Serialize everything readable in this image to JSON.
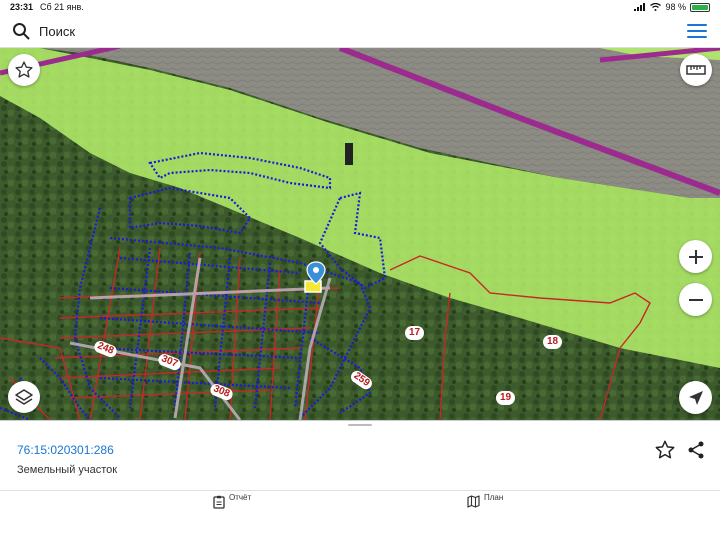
{
  "status_bar": {
    "time": "23:31",
    "date": "Сб 21 янв.",
    "battery": "98 %",
    "battery_level": 0.98
  },
  "search": {
    "placeholder": "Поиск",
    "search_icon": "search-icon",
    "menu_icon": "menu-icon"
  },
  "map": {
    "controls": {
      "favorite_icon": "star-outline-icon",
      "ruler_icon": "ruler-icon",
      "zoom_in_icon": "plus-icon",
      "zoom_out_icon": "minus-icon",
      "layers_icon": "layers-icon",
      "locate_icon": "navigation-arrow-icon"
    },
    "parcel_labels": [
      "248",
      "307",
      "308",
      "259",
      "17",
      "18",
      "19"
    ],
    "marker_icon": "map-pin-icon",
    "colors": {
      "zone_fill": "#b6f16c",
      "parcel_outline": "#c62828",
      "parcel_dotted": "#1a1adb",
      "road": "#9c2a8f",
      "river": "#8a8a82"
    }
  },
  "info": {
    "cadastre_number": "76:15:020301:286",
    "type": "Земельный участок",
    "star_icon": "star-outline-icon",
    "share_icon": "share-icon"
  },
  "bottom_tabs": [
    {
      "label": "Отчёт",
      "icon": "clipboard-icon"
    },
    {
      "label": "План",
      "icon": "map-icon"
    }
  ]
}
